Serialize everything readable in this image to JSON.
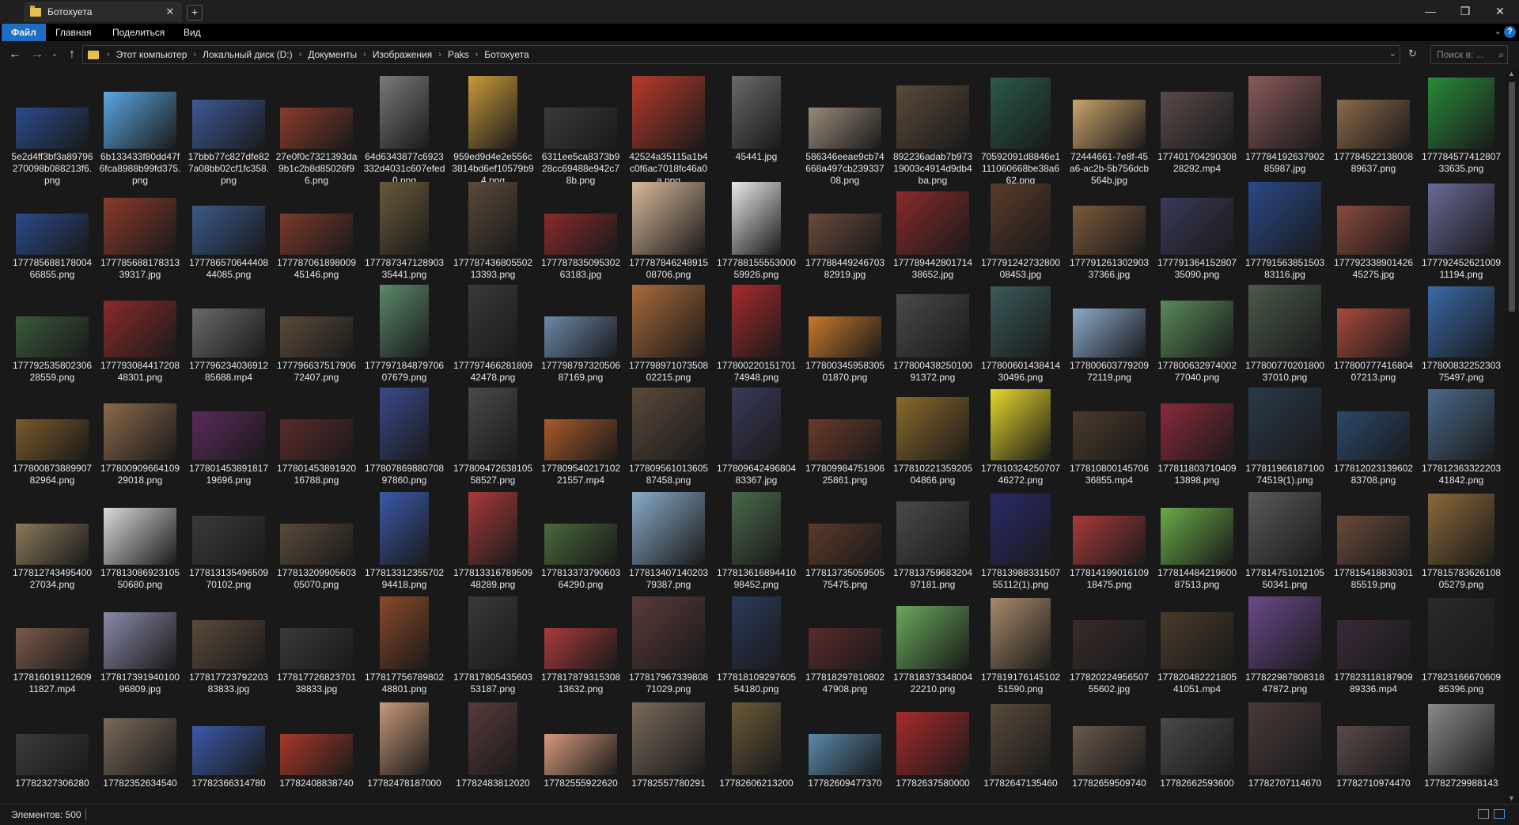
{
  "window": {
    "tab_title": "Ботохуета",
    "tab_close": "✕",
    "new_tab": "+",
    "minimize": "—",
    "maximize": "❐",
    "close": "✕"
  },
  "ribbon": {
    "tabs": [
      "Файл",
      "Главная",
      "Поделиться",
      "Вид"
    ],
    "help": "?"
  },
  "address": {
    "crumbs": [
      "Этот компьютер",
      "Локальный диск (D:)",
      "Документы",
      "Изображения",
      "Paks",
      "Ботохуета"
    ],
    "search_placeholder": "Поиск в: ..."
  },
  "files": [
    {
      "name": "5e2d4ff3bf3a89796270098b088213f6.png",
      "color": "#2a4c8a"
    },
    {
      "name": "6b133433f80dd47f6fca8988b99fd375.png",
      "color": "#5aa7e0"
    },
    {
      "name": "17bbb77c827dfe827a08bb02cf1fc358.png",
      "color": "#3c5a96"
    },
    {
      "name": "27e0f0c7321393da9b1c2b8d85026f96.png",
      "color": "#8a3c2c"
    },
    {
      "name": "64d6343877c6923332d4031c607efed0.png",
      "color": "#7a7a7a"
    },
    {
      "name": "959ed9d4e2e556c3814bd6ef10579b94.png",
      "color": "#c99a3a"
    },
    {
      "name": "6311ee5ca8373b928cc69488e942c78b.png",
      "color": "#3a3a3a"
    },
    {
      "name": "42524a35115a1b4c0f6ac7018fc46a0a.png",
      "color": "#b83a2a"
    },
    {
      "name": "45441.jpg",
      "color": "#6a6a6a"
    },
    {
      "name": "586346eeae9cb74668a497cb23933708.png",
      "color": "#9a8a7a"
    },
    {
      "name": "892236adab7b97319003c4914d9db4ba.png",
      "color": "#5a4a3a"
    },
    {
      "name": "70592091d8846e1111060668be38a662.png",
      "color": "#2a5a4a"
    },
    {
      "name": "72444661-7e8f-45a6-ac2b-5b756dcb564b.jpg",
      "color": "#c8a46a"
    },
    {
      "name": "17740170429030828292.mp4",
      "color": "#5a4a4a"
    },
    {
      "name": "17778419263790285987.jpg",
      "color": "#8a5a5a"
    },
    {
      "name": "17778452213800889637.png",
      "color": "#8a6a4a"
    },
    {
      "name": "17778457741280733635.png",
      "color": "#2a8a3a"
    },
    {
      "name": "17778568817800466855.png",
      "color": "#2a4a8a"
    },
    {
      "name": "17778568817831339317.jpg",
      "color": "#8a3a2a"
    },
    {
      "name": "17778657064440844085.png",
      "color": "#3a5a8a"
    },
    {
      "name": "17778706189800945146.png",
      "color": "#7a3a2a"
    },
    {
      "name": "17778734712890335441.png",
      "color": "#6a5a3a"
    },
    {
      "name": "17778743680550213393.png",
      "color": "#5a4a3a"
    },
    {
      "name": "17778783509530263183.jpg",
      "color": "#8a2a2a"
    },
    {
      "name": "17778784624891508706.png",
      "color": "#d8b89a"
    },
    {
      "name": "17778815555300059926.png",
      "color": "#e8e8e8"
    },
    {
      "name": "17778844924670382919.jpg",
      "color": "#6a4a3a"
    },
    {
      "name": "17778944280171438652.jpg",
      "color": "#8a2a2a"
    },
    {
      "name": "17779124273280008453.jpg",
      "color": "#5a3a2a"
    },
    {
      "name": "17779126130290337366.jpg",
      "color": "#7a5a3a"
    },
    {
      "name": "17779136415280735090.png",
      "color": "#3a3a5a"
    },
    {
      "name": "17779156385150383116.jpg",
      "color": "#2a4a8a"
    },
    {
      "name": "17779233890142645275.jpg",
      "color": "#8a4a3a"
    },
    {
      "name": "17779245262100911194.png",
      "color": "#6a6a9a"
    },
    {
      "name": "17779253580230628559.png",
      "color": "#3a5a3a"
    },
    {
      "name": "17779308441720848301.png",
      "color": "#8a2a2a"
    },
    {
      "name": "17779623403691285688.mp4",
      "color": "#6a6a6a"
    },
    {
      "name": "17779663751790672407.png",
      "color": "#5a4a3a"
    },
    {
      "name": "17779718487970607679.png",
      "color": "#5a8a6a"
    },
    {
      "name": "17779746628180942478.png",
      "color": "#3a3a3a"
    },
    {
      "name": "17779879732050687169.png",
      "color": "#6a8aaa"
    },
    {
      "name": "17779897107350802215.png",
      "color": "#aa6a3a"
    },
    {
      "name": "17780022015170174948.png",
      "color": "#aa2a2a"
    },
    {
      "name": "17780034595830501870.png",
      "color": "#c87a2a"
    },
    {
      "name": "17780043825010091372.png",
      "color": "#4a4a4a"
    },
    {
      "name": "17780060143841430496.png",
      "color": "#3a5a5a"
    },
    {
      "name": "17780060377920972119.png",
      "color": "#8aaaca"
    },
    {
      "name": "17780063297400277040.png",
      "color": "#5a8a5a"
    },
    {
      "name": "17780077020180037010.png",
      "color": "#4a5a4a"
    },
    {
      "name": "17780077741680407213.png",
      "color": "#aa4a3a"
    },
    {
      "name": "17780083225230375497.png",
      "color": "#3a6aaa"
    },
    {
      "name": "17780087388990782964.png",
      "color": "#7a5a2a"
    },
    {
      "name": "17780090966410929018.png",
      "color": "#8a6a4a"
    },
    {
      "name": "17780145389181719696.png",
      "color": "#5a2a5a"
    },
    {
      "name": "17780145389192016788.png",
      "color": "#5a2a2a"
    },
    {
      "name": "17780786988070897860.png",
      "color": "#3a4a8a"
    },
    {
      "name": "17780947263810558527.png",
      "color": "#4a4a4a"
    },
    {
      "name": "17780954021710221557.mp4",
      "color": "#aa5a2a"
    },
    {
      "name": "17780956101360587458.png",
      "color": "#5a4a3a"
    },
    {
      "name": "17780964249680483367.jpg",
      "color": "#3a3a5a"
    },
    {
      "name": "17780998475190625861.png",
      "color": "#6a3a2a"
    },
    {
      "name": "17781022135920504866.png",
      "color": "#8a6a2a"
    },
    {
      "name": "17781032425070746272.png",
      "color": "#e8d82a"
    },
    {
      "name": "17781080014570636855.mp4",
      "color": "#4a3a2a"
    },
    {
      "name": "17781180371040913898.png",
      "color": "#8a2a3a"
    },
    {
      "name": "17781196618710074519(1).png",
      "color": "#2a3a4a"
    },
    {
      "name": "17781202313960283708.png",
      "color": "#2a4a6a"
    },
    {
      "name": "17781236332220341842.png",
      "color": "#4a6a8a"
    },
    {
      "name": "17781274349540027034.png",
      "color": "#8a7a5a"
    },
    {
      "name": "17781308692310550680.png",
      "color": "#dadada"
    },
    {
      "name": "17781313549650970102.png",
      "color": "#3a3a3a"
    },
    {
      "name": "17781320990560305070.png",
      "color": "#5a4a3a"
    },
    {
      "name": "17781331235570294418.png",
      "color": "#3a5aaa"
    },
    {
      "name": "17781331678950948289.png",
      "color": "#aa3a3a"
    },
    {
      "name": "17781337379060364290.png",
      "color": "#4a6a3a"
    },
    {
      "name": "17781340714020379387.png",
      "color": "#8aaaca"
    },
    {
      "name": "17781361689441098452.png",
      "color": "#4a6a4a"
    },
    {
      "name": "17781373505950575475.png",
      "color": "#5a3a2a"
    },
    {
      "name": "17781375968320497181.png",
      "color": "#4a4a4a"
    },
    {
      "name": "17781398833150755112(1).png",
      "color": "#2a2a6a"
    },
    {
      "name": "17781419901610918475.png",
      "color": "#aa3a3a"
    },
    {
      "name": "17781448421960087513.png",
      "color": "#6aaa4a"
    },
    {
      "name": "17781475101210550341.png",
      "color": "#5a5a5a"
    },
    {
      "name": "17781541883030185519.png",
      "color": "#6a4a3a"
    },
    {
      "name": "17781578362610805279.png",
      "color": "#8a6a3a"
    },
    {
      "name": "17781601911260911827.mp4",
      "color": "#7a5a4a"
    },
    {
      "name": "17781739194010096809.jpg",
      "color": "#8a8aaa"
    },
    {
      "name": "17781772379220383833.jpg",
      "color": "#5a4a3a"
    },
    {
      "name": "17781772682370138833.jpg",
      "color": "#3a3a3a"
    },
    {
      "name": "17781775678980248801.png",
      "color": "#8a4a2a"
    },
    {
      "name": "17781780543560353187.png",
      "color": "#3a3a3a"
    },
    {
      "name": "17781787931530813632.png",
      "color": "#aa3a3a"
    },
    {
      "name": "17781796733980871029.png",
      "color": "#5a3a3a"
    },
    {
      "name": "17781810929760554180.png",
      "color": "#2a3a5a"
    },
    {
      "name": "17781829781080247908.png",
      "color": "#5a2a2a"
    },
    {
      "name": "17781837334800422210.png",
      "color": "#6aaa5a"
    },
    {
      "name": "17781917614510251590.png",
      "color": "#aa8a6a"
    },
    {
      "name": "17782022495650755602.jpg",
      "color": "#3a2a2a"
    },
    {
      "name": "17782048222180541051.mp4",
      "color": "#4a3a2a"
    },
    {
      "name": "17782298780831847872.png",
      "color": "#6a4a8a"
    },
    {
      "name": "17782311818790989336.mp4",
      "color": "#3a2a3a"
    },
    {
      "name": "17782316667060985396.png",
      "color": "#2a2a2a"
    },
    {
      "name": "17782327306280",
      "color": "#3a3a3a"
    },
    {
      "name": "17782352634540",
      "color": "#7a6a5a"
    },
    {
      "name": "17782366314780",
      "color": "#3a5aaa"
    },
    {
      "name": "17782408838740",
      "color": "#aa3a2a"
    },
    {
      "name": "17782478187000",
      "color": "#c89a7a"
    },
    {
      "name": "17782483812020",
      "color": "#5a3a3a"
    },
    {
      "name": "17782555922620",
      "color": "#d89a7a"
    },
    {
      "name": "17782557780291",
      "color": "#7a6a5a"
    },
    {
      "name": "17782606213200",
      "color": "#6a5a3a"
    },
    {
      "name": "17782609477370",
      "color": "#5a8aaa"
    },
    {
      "name": "17782637580000",
      "color": "#aa2a2a"
    },
    {
      "name": "17782647135460",
      "color": "#5a4a3a"
    },
    {
      "name": "17782659509740",
      "color": "#6a5a4a"
    },
    {
      "name": "17782662593600",
      "color": "#4a4a4a"
    },
    {
      "name": "17782707114670",
      "color": "#4a3a3a"
    },
    {
      "name": "17782710974470",
      "color": "#5a4a4a"
    },
    {
      "name": "17782729988143",
      "color": "#8a8a8a"
    }
  ],
  "status": {
    "count_label": "Элементов: 500"
  }
}
